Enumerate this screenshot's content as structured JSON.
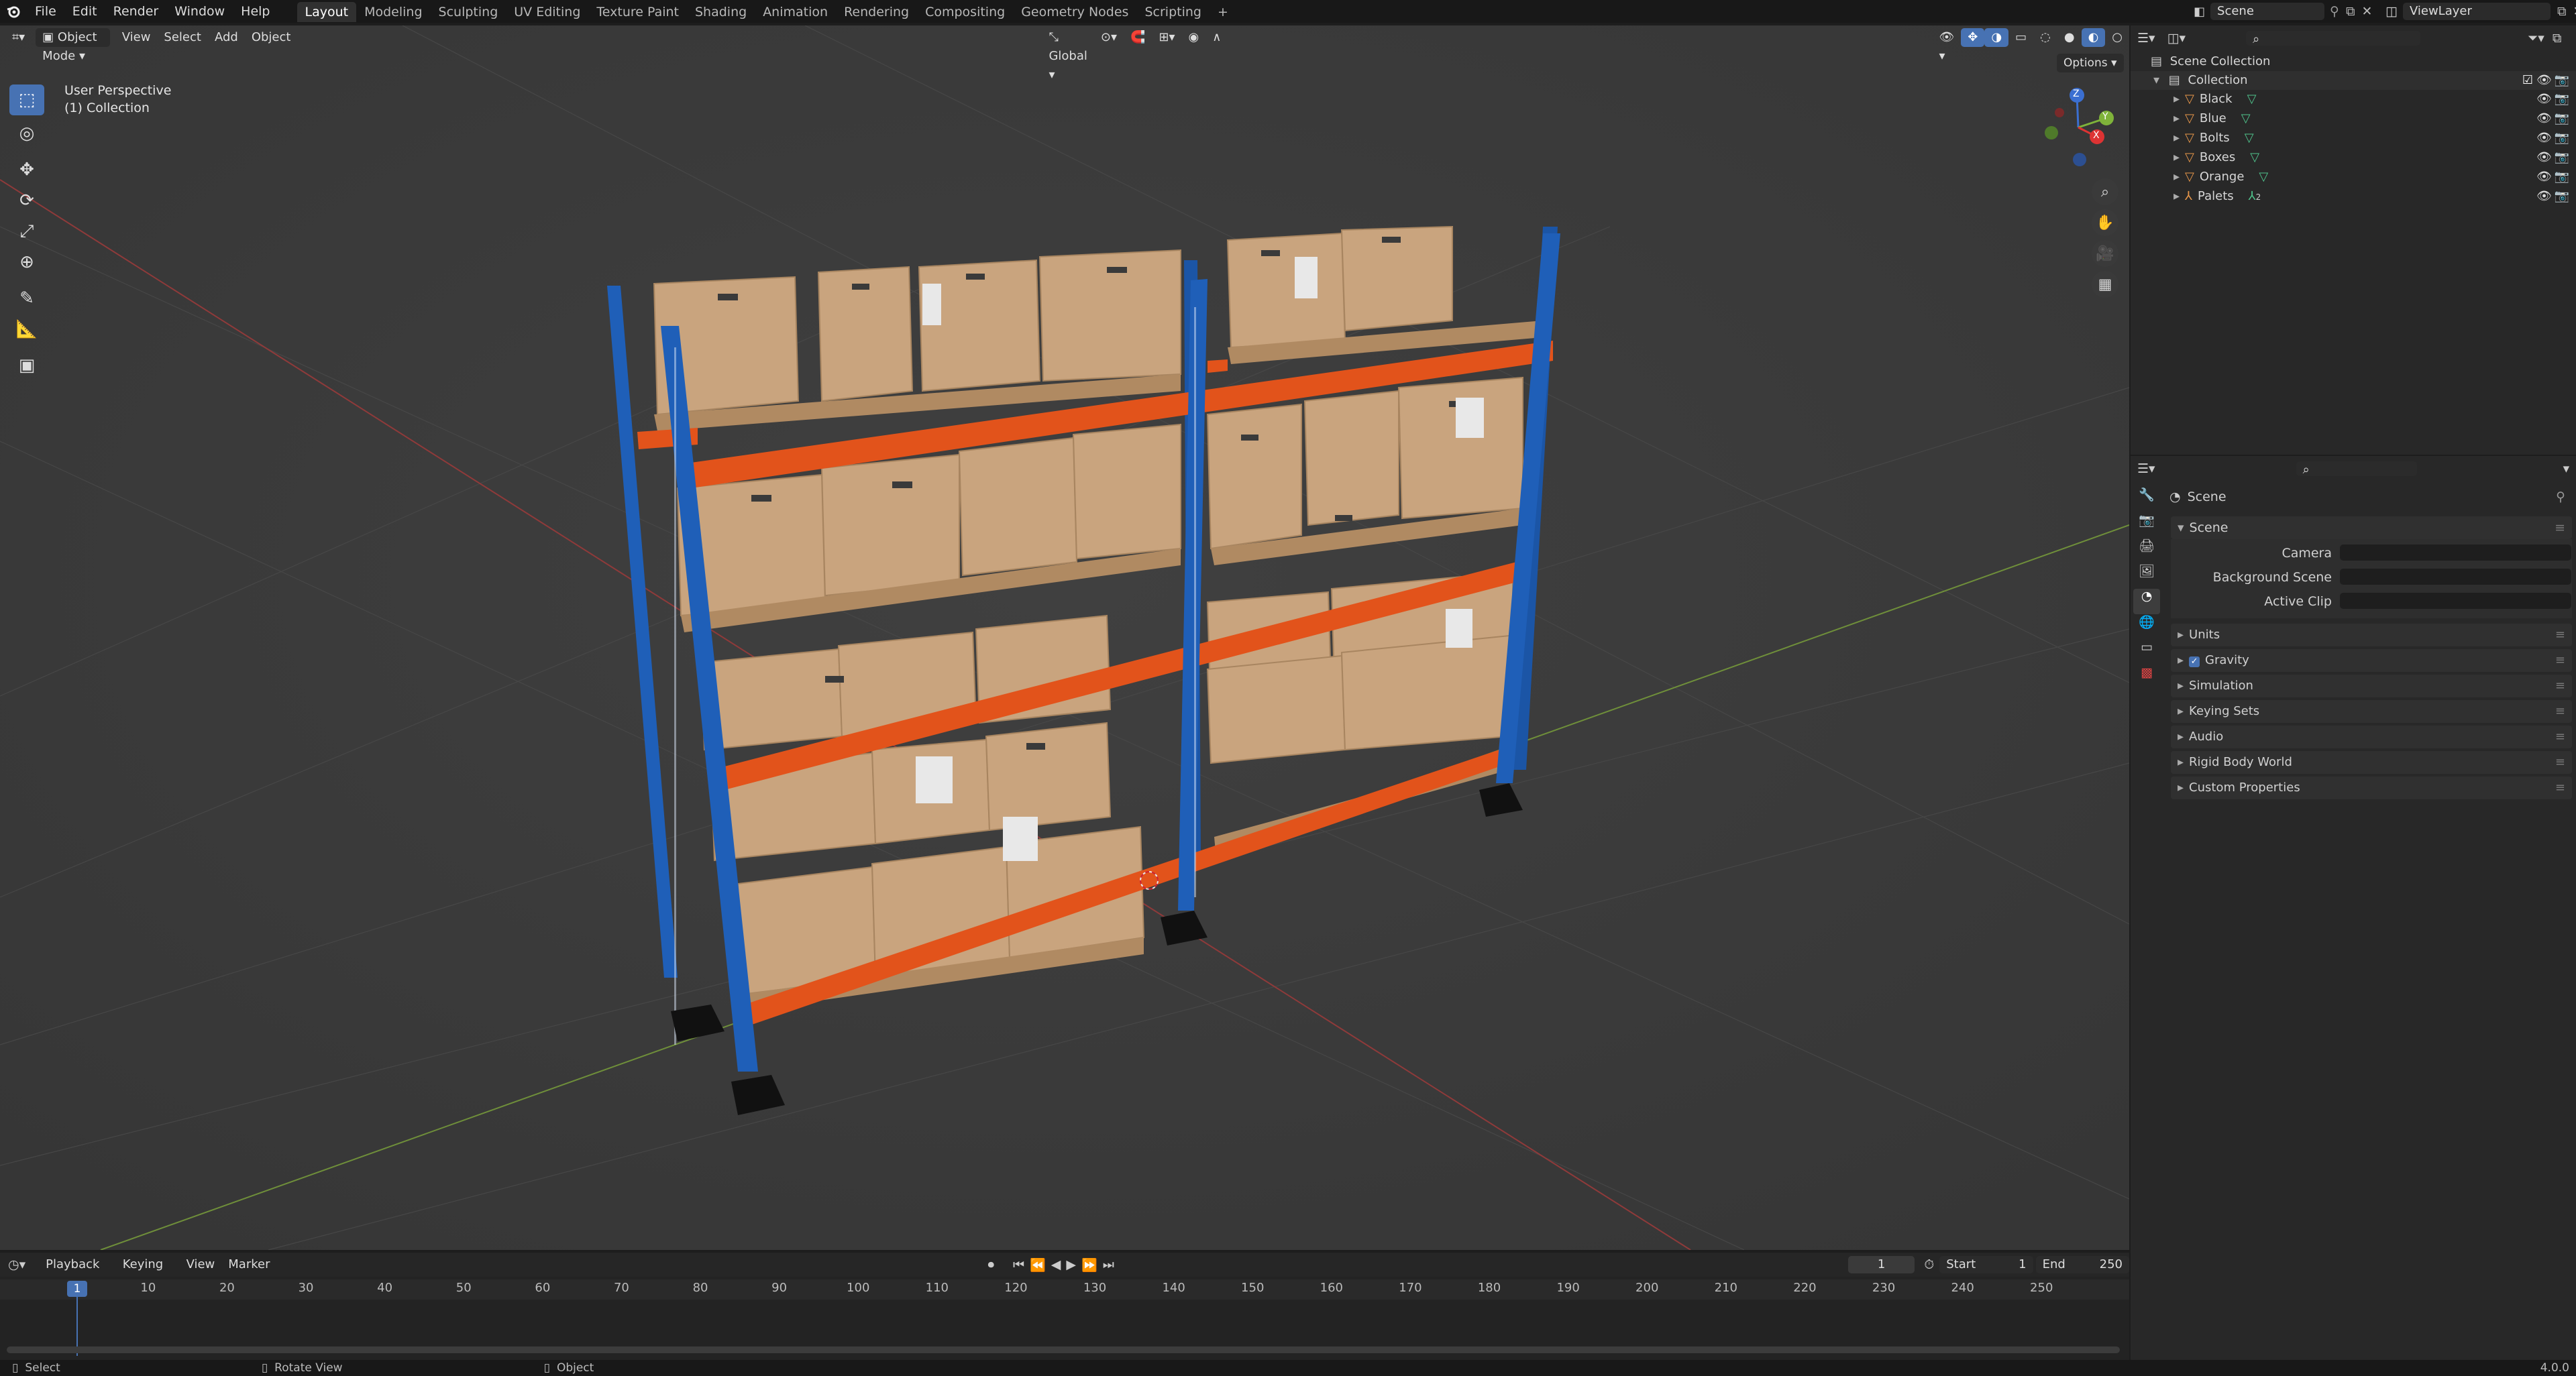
{
  "topbar": {
    "menus": [
      "File",
      "Edit",
      "Render",
      "Window",
      "Help"
    ],
    "workspaces": [
      "Layout",
      "Modeling",
      "Sculpting",
      "UV Editing",
      "Texture Paint",
      "Shading",
      "Animation",
      "Rendering",
      "Compositing",
      "Geometry Nodes",
      "Scripting"
    ],
    "active_workspace": "Layout",
    "add_tab": "+",
    "scene_name": "Scene",
    "view_layer": "ViewLayer"
  },
  "viewport_header": {
    "mode": "Object Mode",
    "menus": [
      "View",
      "Select",
      "Add",
      "Object"
    ],
    "orientation": "Global",
    "options_label": "Options"
  },
  "viewport_overlay": {
    "perspective": "User Perspective",
    "collection": "(1) Collection",
    "gizmo": {
      "x": "X",
      "y": "Y",
      "z": "Z"
    }
  },
  "outliner": {
    "root": "Scene Collection",
    "collection": "Collection",
    "items": [
      {
        "name": "Black",
        "kind": "mesh"
      },
      {
        "name": "Blue",
        "kind": "mesh"
      },
      {
        "name": "Bolts",
        "kind": "mesh"
      },
      {
        "name": "Boxes",
        "kind": "mesh"
      },
      {
        "name": "Orange",
        "kind": "mesh"
      },
      {
        "name": "Palets",
        "kind": "empty",
        "badge": "2"
      }
    ]
  },
  "properties": {
    "context": "Scene",
    "panel": "Scene",
    "fields": [
      {
        "label": "Camera",
        "value": ""
      },
      {
        "label": "Background Scene",
        "value": ""
      },
      {
        "label": "Active Clip",
        "value": ""
      }
    ],
    "sections": [
      {
        "label": "Units",
        "checkbox": false
      },
      {
        "label": "Gravity",
        "checkbox": true
      },
      {
        "label": "Simulation",
        "checkbox": false
      },
      {
        "label": "Keying Sets",
        "checkbox": false
      },
      {
        "label": "Audio",
        "checkbox": false
      },
      {
        "label": "Rigid Body World",
        "checkbox": false
      },
      {
        "label": "Custom Properties",
        "checkbox": false
      }
    ]
  },
  "timeline": {
    "menus": [
      "Playback",
      "Keying",
      "View",
      "Marker"
    ],
    "current_frame": "1",
    "start_label": "Start",
    "start_value": "1",
    "end_label": "End",
    "end_value": "250",
    "ticks": [
      "1",
      "10",
      "20",
      "30",
      "40",
      "50",
      "60",
      "70",
      "80",
      "90",
      "100",
      "110",
      "120",
      "130",
      "140",
      "150",
      "160",
      "170",
      "180",
      "190",
      "200",
      "210",
      "220",
      "230",
      "240",
      "250"
    ]
  },
  "statusbar": {
    "select": "Select",
    "rotate": "Rotate View",
    "object": "Object",
    "version": "4.0.0"
  },
  "colors": {
    "accent": "#4772b3",
    "rack_blue": "#1f5fb8",
    "rack_orange": "#e2531b",
    "box": "#c9a47e",
    "viewport_bg": "#3b3b3b"
  }
}
